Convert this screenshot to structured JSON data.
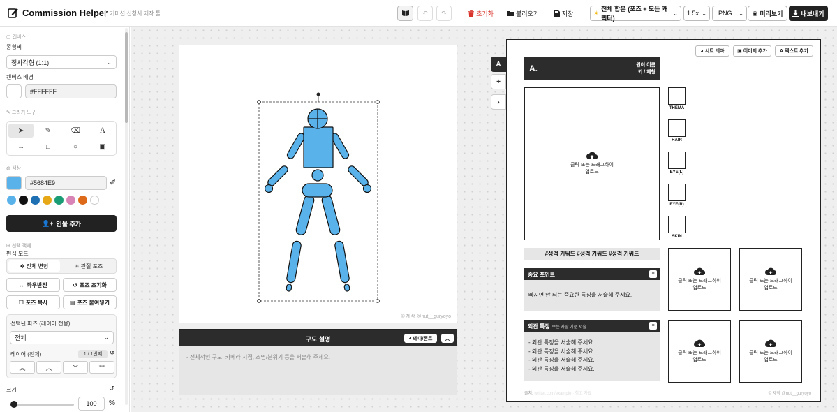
{
  "header": {
    "title": "Commission Helper",
    "subtitle": "커미션 신청서 제작 툴",
    "reset_label": "초기화",
    "load_label": "불러오기",
    "save_label": "저장",
    "scope_select": "전체 합본 (포즈 + 모든 캐릭터)",
    "scale_select": "1.5x",
    "format_select": "PNG",
    "preview_label": "미리보기",
    "export_label": "내보내기",
    "icons": [
      "book-icon",
      "undo-icon",
      "redo-icon",
      "trash-icon",
      "folder-icon",
      "save-icon",
      "sun-icon",
      "eye-icon",
      "download-icon"
    ]
  },
  "left_panel": {
    "canvas_section": "캔버스",
    "ratio_label": "종횡비",
    "ratio_value": "정사각형 (1:1)",
    "bg_label": "캔버스 배경",
    "bg_value": "#FFFFFF",
    "draw_section": "그리기 도구",
    "color_section": "색상",
    "color_value": "#5684E9",
    "palette": [
      "#5ab2ea",
      "#111111",
      "#1f6fb3",
      "#e6a817",
      "#1a9c75",
      "#d884b6",
      "#dd6a1a",
      "#ffffff"
    ],
    "add_person_label": "인물 추가",
    "selected_section": "선택 객체",
    "edit_mode_label": "편집 모드",
    "mode_all": "전체 변형",
    "mode_joint": "관절 포즈",
    "flip_label": "좌우반전",
    "pose_reset_label": "포즈 초기화",
    "pose_copy_label": "포즈 복사",
    "pose_paste_label": "포즈 붙여넣기",
    "parts_label": "선택된 파츠 (레이어 전용)",
    "parts_value": "전체",
    "layer_label": "레이어 (전체)",
    "layer_badge": "1 / 1번째",
    "size_label": "크기",
    "size_value": "100",
    "size_unit": "%",
    "size_fraction": 0.05
  },
  "canvas": {
    "credit": "© 제작 @nut__guryoyo",
    "figure_color": "#5ab2ea"
  },
  "composition": {
    "title": "구도 설명",
    "theme_label": "테마/폰트",
    "placeholder": "- 전체적인 구도, 카메라 시점, 조명/분위기 등을 서술해 주세요."
  },
  "side_tabs": {
    "tab_a": "A",
    "add": "+",
    "expand": "›"
  },
  "sheet": {
    "theme_btn": "시트 테마",
    "add_image_btn": "이미지 추가",
    "add_text_btn": "텍스트 추가",
    "name_letter": "A.",
    "name_line1": "원어 이름",
    "name_line2": "키 / 체형",
    "upload_text": "클릭 또는 드래그하여 업로드",
    "swatch_labels": [
      "THEMA",
      "HAIR",
      "EYE(L)",
      "EYE(R)",
      "SKIN"
    ],
    "tags": "#성격 키워드 #성격 키워드 #성격 키워드",
    "point_title": "중요 포인트",
    "point_body": "빠지면 안 되는 중요한 특징을 서술해 주세요.",
    "look_title": "외관 특징",
    "look_sub": "보는 사람 기준 서술",
    "look_lines": [
      "- 외관 특징을 서술해 주세요.",
      "- 외관 특징을 서술해 주세요.",
      "- 외관 특징을 서술해 주세요.",
      "- 외관 특징을 서술해 주세요."
    ],
    "source_label": "출처:",
    "source_value": "twitter.com/example · 참고 자료",
    "credit": "© 제작 @nut__guryoyo"
  }
}
